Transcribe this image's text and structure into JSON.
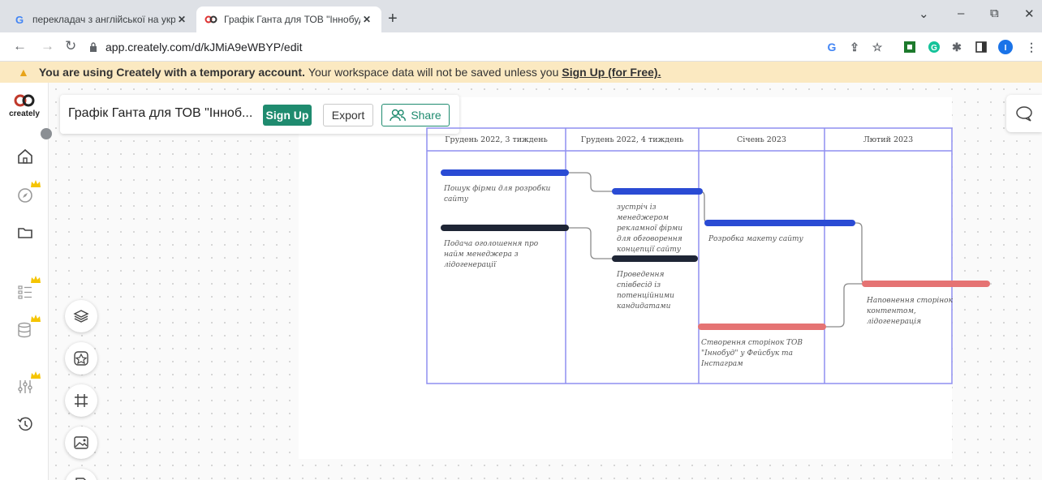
{
  "browser": {
    "tabs": [
      {
        "title": "перекладач з англійської на укр",
        "favicon": "G",
        "favicon_color": "#4285f4",
        "close": "✕"
      },
      {
        "title": "Графік Ганта для ТОВ \"Іннобуд\"",
        "favicon": "creately-icon",
        "close": "✕"
      }
    ],
    "new_tab": "+",
    "window_controls": {
      "minimize": "–",
      "restore": "⧉",
      "close": "✕",
      "dropdown": "⌄"
    },
    "url": "app.creately.com/d/kJMiA9eWBYP/edit"
  },
  "banner": {
    "bold_text": "You are using Creately with a temporary account.",
    "text": "Your workspace data will not be saved unless you",
    "link": "Sign Up (for Free)."
  },
  "app": {
    "logo_text": "creately",
    "doc_title": "Графік Ганта для ТОВ \"Інноб...",
    "signup_label": "Sign Up",
    "export_label": "Export",
    "share_label": "Share",
    "accent_color": "#1f8b6f",
    "crown_color": "#f5c400"
  },
  "gantt": {
    "columns": [
      "Грудень 2022, 3 тиждень",
      "Грудень 2022, 4 тиждень",
      "Січень 2023",
      "Лютий 2023"
    ],
    "tasks": [
      {
        "label": "Пошук фірми для розробки сайту",
        "color": "#2a4bd4"
      },
      {
        "label": "Подача оголошення про найм менеджера з лідогенерації",
        "color": "#1e2535"
      },
      {
        "label": "зустріч із менеджером рекламної фірми для обговорення концепції сайту",
        "color": "#2a4bd4"
      },
      {
        "label": "Проведення співбесід із потенційними кандидатами",
        "color": "#1e2535"
      },
      {
        "label": "Розробка макету сайту",
        "color": "#2a4bd4"
      },
      {
        "label": "Створення сторінок ТОВ \"Іннобуд\" у Фейсбук та Інстаграм",
        "color": "#e57373"
      },
      {
        "label": "Наповнення сторінок контентом, лідогенерація",
        "color": "#e57373"
      }
    ],
    "grid_color": "#8f8ff0"
  }
}
